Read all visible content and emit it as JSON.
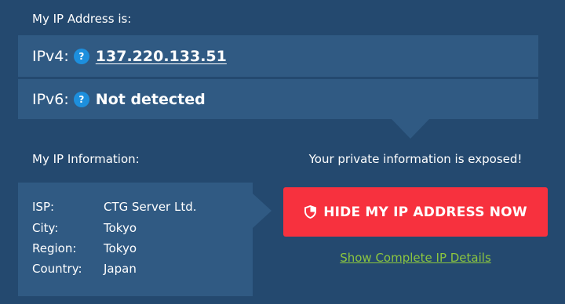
{
  "ip_address": {
    "heading": "My IP Address is:",
    "ipv4": {
      "label": "IPv4:",
      "help": "?",
      "value": "137.220.133.51"
    },
    "ipv6": {
      "label": "IPv6:",
      "help": "?",
      "value": "Not detected"
    }
  },
  "ip_information": {
    "heading": "My IP Information:",
    "rows": [
      {
        "key": "ISP:",
        "value": "CTG Server Ltd."
      },
      {
        "key": "City:",
        "value": "Tokyo"
      },
      {
        "key": "Region:",
        "value": "Tokyo"
      },
      {
        "key": "Country:",
        "value": "Japan"
      }
    ]
  },
  "exposure": {
    "message": "Your private information is exposed!",
    "button_label": "HIDE MY IP ADDRESS NOW",
    "button_icon": "shield-icon",
    "details_link": "Show Complete IP Details"
  },
  "colors": {
    "background": "#24496f",
    "panel": "#305a83",
    "accent_red": "#f7313e",
    "help_blue": "#1d8fdd",
    "link_green": "#8cc63f"
  }
}
